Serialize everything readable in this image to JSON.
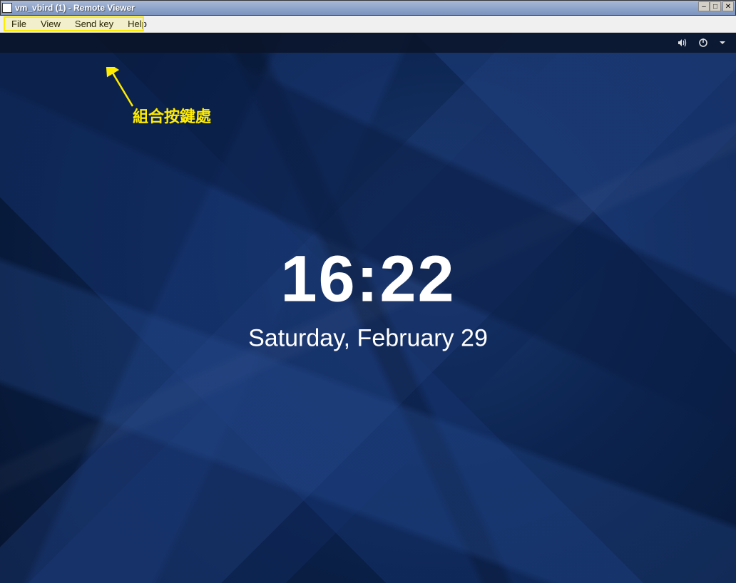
{
  "window": {
    "title": "vm_vbird (1) - Remote Viewer"
  },
  "menu": {
    "file": "File",
    "view": "View",
    "sendkey": "Send key",
    "help": "Help"
  },
  "lockscreen": {
    "time": "16:22",
    "date": "Saturday, February 29"
  },
  "annotation": {
    "label": "組合按鍵處"
  },
  "icons": {
    "volume": "volume-icon",
    "power": "power-icon",
    "dropdown": "chevron-down-icon",
    "minimize": "–",
    "maximize": "□",
    "close": "✕"
  }
}
